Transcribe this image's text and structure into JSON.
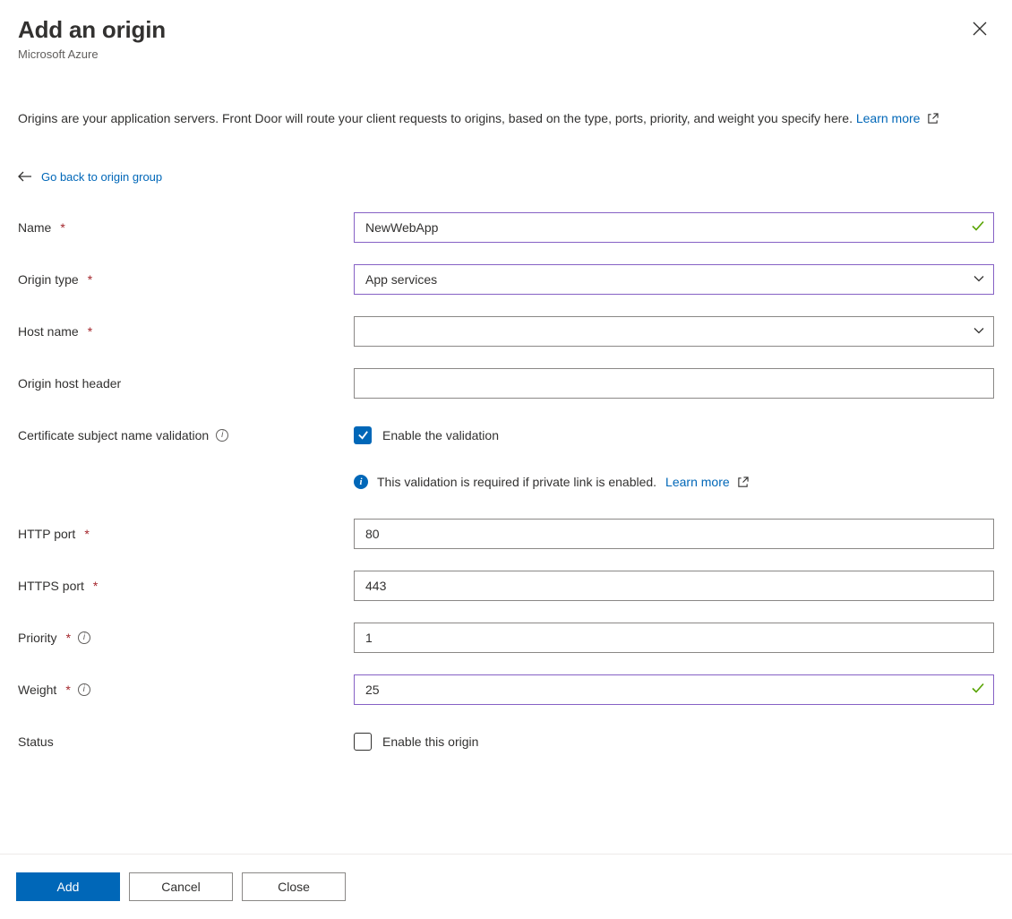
{
  "panel": {
    "title": "Add an origin",
    "subtitle": "Microsoft Azure"
  },
  "description": {
    "text": "Origins are your application servers. Front Door will route your client requests to origins, based on the type, ports, priority, and weight you specify here. ",
    "learn_more": "Learn more"
  },
  "back_link": "Go back to origin group",
  "fields": {
    "name": {
      "label": "Name",
      "value": "NewWebApp"
    },
    "origin_type": {
      "label": "Origin type",
      "value": "App services"
    },
    "host_name": {
      "label": "Host name",
      "value": ""
    },
    "origin_host_header": {
      "label": "Origin host header",
      "value": ""
    },
    "cert_validation": {
      "label": "Certificate subject name validation",
      "checkbox_label": "Enable the validation",
      "checked": true,
      "info_text": "This validation is required if private link is enabled. ",
      "info_learn_more": "Learn more"
    },
    "http_port": {
      "label": "HTTP port",
      "value": "80"
    },
    "https_port": {
      "label": "HTTPS port",
      "value": "443"
    },
    "priority": {
      "label": "Priority",
      "value": "1"
    },
    "weight": {
      "label": "Weight",
      "value": "25"
    },
    "status": {
      "label": "Status",
      "checkbox_label": "Enable this origin",
      "checked": false
    }
  },
  "buttons": {
    "add": "Add",
    "cancel": "Cancel",
    "close": "Close"
  }
}
